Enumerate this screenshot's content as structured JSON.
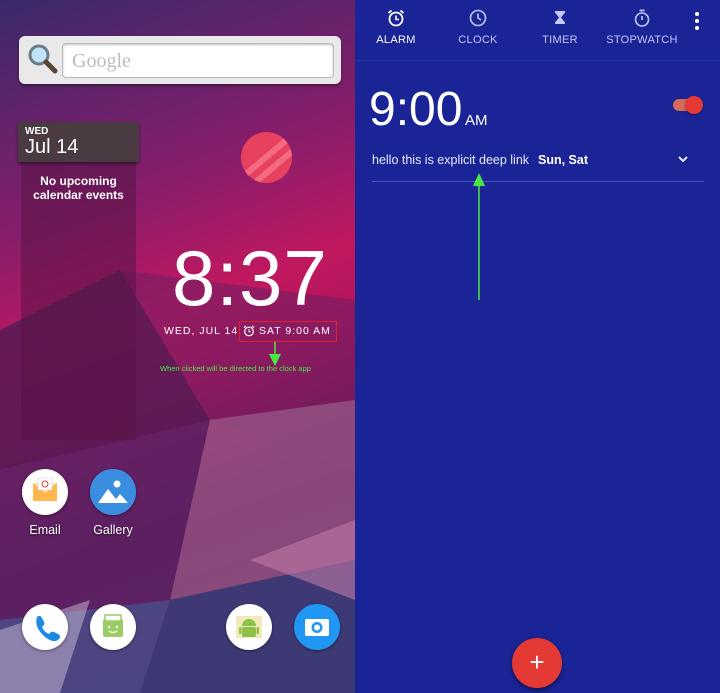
{
  "launcher": {
    "search_placeholder": "Google",
    "calendar": {
      "dow": "WED",
      "date": "Jul 14",
      "empty_text": "No upcoming\ncalendar events"
    },
    "clock": {
      "time": "8:37",
      "date": "WED, JUL 14",
      "next_alarm": "SAT 9:00 AM"
    },
    "annotation": "When clicked will be directed to the clock app",
    "apps": [
      {
        "label": "Email",
        "icon": "email-icon"
      },
      {
        "label": "Gallery",
        "icon": "gallery-icon"
      }
    ],
    "dock": [
      "phone-icon",
      "market-icon",
      "android-app-icon",
      "camera-icon"
    ]
  },
  "clock_app": {
    "tabs": [
      {
        "label": "ALARM",
        "icon": "alarm-icon",
        "active": true
      },
      {
        "label": "CLOCK",
        "icon": "clock-icon",
        "active": false
      },
      {
        "label": "TIMER",
        "icon": "hourglass-icon",
        "active": false
      },
      {
        "label": "STOPWATCH",
        "icon": "stopwatch-icon",
        "active": false
      }
    ],
    "alarm": {
      "time": "9:00",
      "ampm": "AM",
      "label": "hello this is explicit deep link",
      "days": "Sun, Sat",
      "enabled": true
    },
    "fab_label": "+"
  },
  "colors": {
    "app_bg": "#1a2496",
    "accent": "#e53935",
    "annotation": "#47e843",
    "highlight_box": "#e0202e"
  }
}
